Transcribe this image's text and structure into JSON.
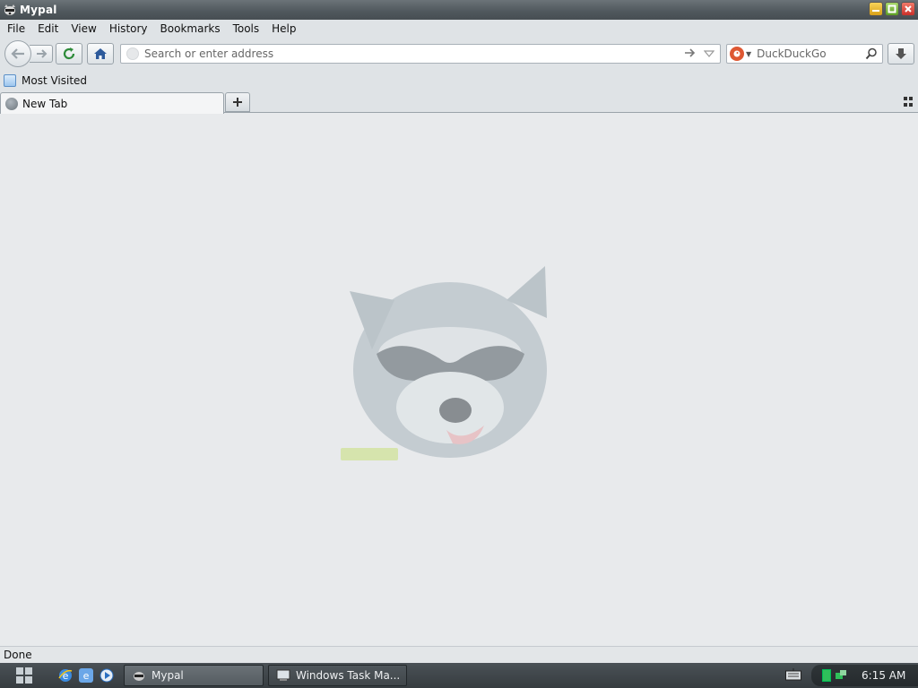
{
  "window": {
    "title": "Mypal",
    "icon": "raccoon-icon"
  },
  "menu": [
    "File",
    "Edit",
    "View",
    "History",
    "Bookmarks",
    "Tools",
    "Help"
  ],
  "navbar": {
    "url_placeholder": "Search or enter address",
    "url_value": "",
    "search_engine": "DuckDuckGo",
    "search_placeholder": "DuckDuckGo",
    "search_value": ""
  },
  "bookmarks": {
    "most_visited": "Most Visited"
  },
  "tabs": [
    {
      "label": "New Tab",
      "active": true
    }
  ],
  "status": {
    "text": "Done"
  },
  "taskbar": {
    "tasks": [
      {
        "label": "Mypal",
        "active": true
      },
      {
        "label": "Windows Task Ma...",
        "active": false
      }
    ],
    "clock": "6:15 AM"
  },
  "colors": {
    "accent": "#de5833",
    "titlebar": "#4f575c",
    "background": "#e8eaec"
  }
}
